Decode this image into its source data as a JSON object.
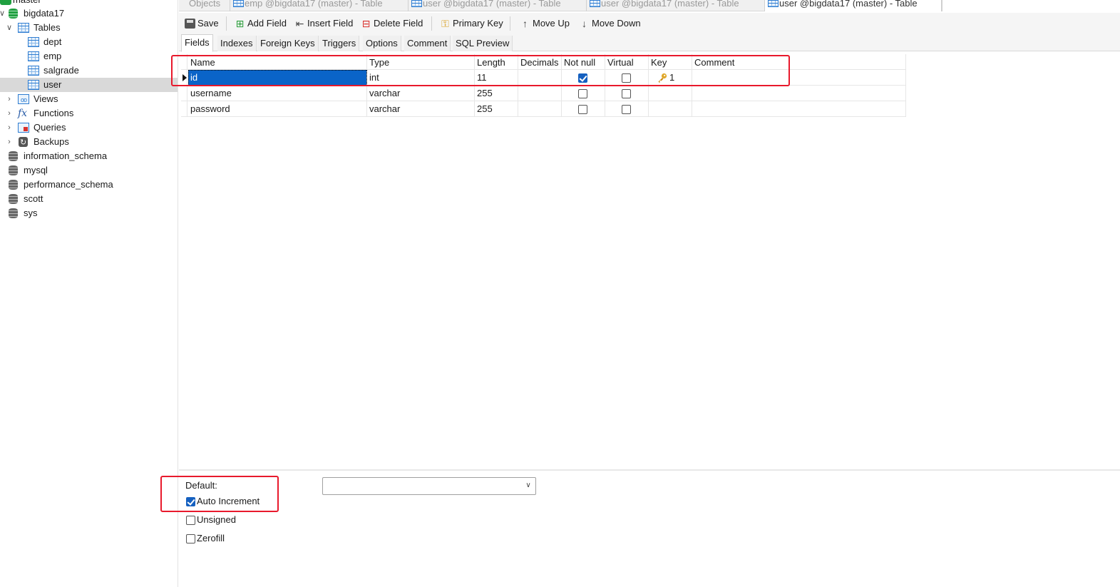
{
  "tree": {
    "connection": "master",
    "database": "bigdata17",
    "tables_label": "Tables",
    "tables": [
      "dept",
      "emp",
      "salgrade",
      "user"
    ],
    "selected_table": "user",
    "groups": [
      "Views",
      "Functions",
      "Queries",
      "Backups"
    ],
    "other_databases": [
      "information_schema",
      "mysql",
      "performance_schema",
      "scott",
      "sys"
    ]
  },
  "tabs": [
    {
      "label": "Objects"
    },
    {
      "label": "emp @bigdata17 (master) - Table"
    },
    {
      "label": "user @bigdata17 (master) - Table"
    },
    {
      "label": "user @bigdata17 (master) - Table"
    },
    {
      "label": "user @bigdata17 (master) - Table"
    }
  ],
  "toolbar": {
    "save": "Save",
    "add_field": "Add Field",
    "insert_field": "Insert Field",
    "delete_field": "Delete Field",
    "primary_key": "Primary Key",
    "move_up": "Move Up",
    "move_down": "Move Down"
  },
  "subtabs": [
    "Fields",
    "Indexes",
    "Foreign Keys",
    "Triggers",
    "Options",
    "Comment",
    "SQL Preview"
  ],
  "grid": {
    "columns": [
      "Name",
      "Type",
      "Length",
      "Decimals",
      "Not null",
      "Virtual",
      "Key",
      "Comment"
    ],
    "rows": [
      {
        "name": "id",
        "type": "int",
        "length": "11",
        "decimals": "",
        "not_null": true,
        "virtual": false,
        "key": "1",
        "comment": ""
      },
      {
        "name": "username",
        "type": "varchar",
        "length": "255",
        "decimals": "",
        "not_null": false,
        "virtual": false,
        "key": "",
        "comment": ""
      },
      {
        "name": "password",
        "type": "varchar",
        "length": "255",
        "decimals": "",
        "not_null": false,
        "virtual": false,
        "key": "",
        "comment": ""
      }
    ]
  },
  "options": {
    "default_label": "Default:",
    "default_value": "",
    "auto_increment_label": "Auto Increment",
    "auto_increment": true,
    "unsigned_label": "Unsigned",
    "unsigned": false,
    "zerofill_label": "Zerofill",
    "zerofill": false
  },
  "colors": {
    "selection": "#0a64c8",
    "highlight_box": "#e8192c",
    "db_icon": "#20a040"
  }
}
